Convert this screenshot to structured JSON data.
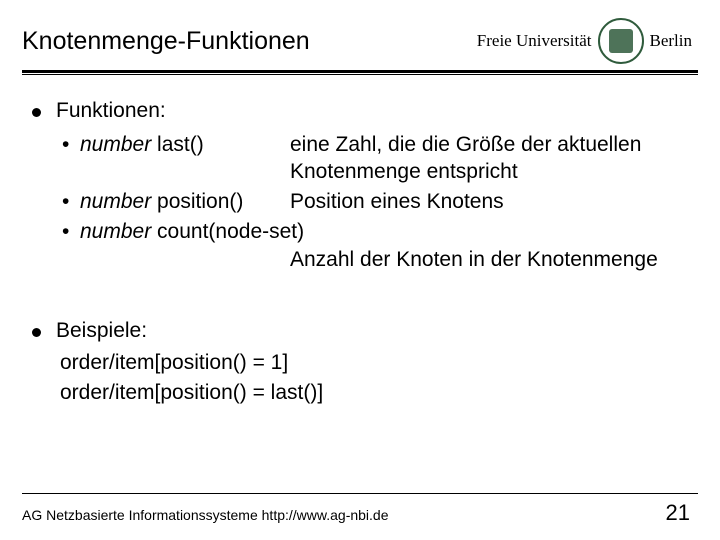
{
  "header": {
    "title": "Knotenmenge-Funktionen",
    "logo_text": "Freie Universität",
    "logo_city": "Berlin"
  },
  "sections": {
    "funktionen_heading": "Funktionen:",
    "items": [
      {
        "type_word": "number",
        "sig": " last()",
        "desc": "eine Zahl, die die Größe der aktuellen Knotenmenge entspricht"
      },
      {
        "type_word": "number",
        "sig": " position()",
        "desc": "Position eines Knotens"
      },
      {
        "type_word": "number",
        "sig": " count(node-set)",
        "desc_cont": "Anzahl der Knoten in der Knotenmenge"
      }
    ],
    "beispiele_heading": "Beispiele:",
    "examples": [
      "order/item[position() = 1]",
      "order/item[position() = last()]"
    ]
  },
  "footer": {
    "left": "AG Netzbasierte Informationssysteme http://www.ag-nbi.de",
    "page": "21"
  }
}
